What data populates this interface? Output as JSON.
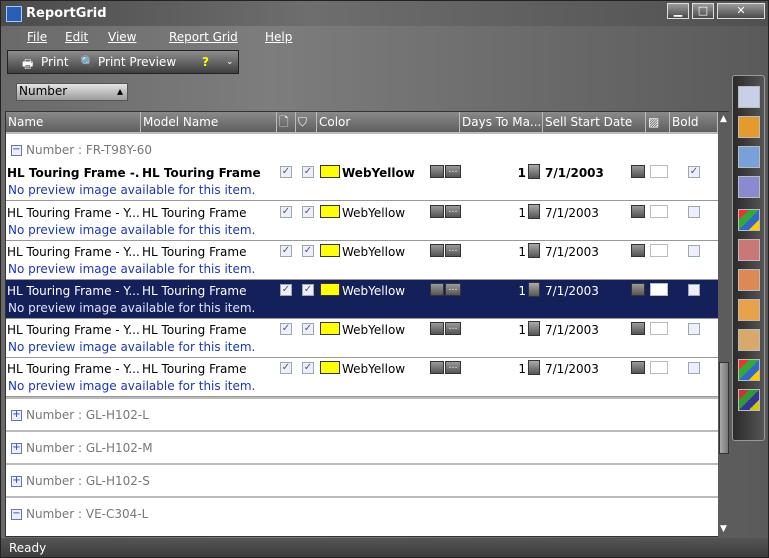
{
  "window": {
    "title": "ReportGrid",
    "min": "▁",
    "max": "□",
    "close": "✕"
  },
  "menu": [
    "File",
    "Edit",
    "View",
    "Report Grid",
    "Help"
  ],
  "toolbar": {
    "print": "Print",
    "print_preview": "Print Preview",
    "help": "?"
  },
  "groupby": {
    "label": "Number"
  },
  "columns": [
    "Name",
    "Model Name",
    "",
    "",
    "Color",
    "Days To Ma...",
    "Sell Start Date",
    "",
    "Bold"
  ],
  "groups": [
    {
      "label": "Number : FR-T98Y-60",
      "expanded": true
    },
    {
      "label": "Number : GL-H102-L",
      "expanded": false
    },
    {
      "label": "Number : GL-H102-M",
      "expanded": false
    },
    {
      "label": "Number : GL-H102-S",
      "expanded": false
    },
    {
      "label": "Number : VE-C304-L",
      "expanded": true
    }
  ],
  "records": [
    {
      "name": "HL Touring Frame -...",
      "model": "HL Touring Frame",
      "color": "WebYellow",
      "days": "1",
      "date": "7/1/2003",
      "preview": "No preview image available for this item.",
      "bold": true,
      "selected": false
    },
    {
      "name": "HL Touring Frame - Y...",
      "model": "HL Touring Frame",
      "color": "WebYellow",
      "days": "1",
      "date": "7/1/2003",
      "preview": "No preview image available for this item.",
      "bold": false,
      "selected": false
    },
    {
      "name": "HL Touring Frame - Y...",
      "model": "HL Touring Frame",
      "color": "WebYellow",
      "days": "1",
      "date": "7/1/2003",
      "preview": "No preview image available for this item.",
      "bold": false,
      "selected": false
    },
    {
      "name": "HL Touring Frame - Y...",
      "model": "HL Touring Frame",
      "color": "WebYellow",
      "days": "1",
      "date": "7/1/2003",
      "preview": "No preview image available for this item.",
      "bold": false,
      "selected": true
    },
    {
      "name": "HL Touring Frame - Y...",
      "model": "HL Touring Frame",
      "color": "WebYellow",
      "days": "1",
      "date": "7/1/2003",
      "preview": "No preview image available for this item.",
      "bold": false,
      "selected": false
    },
    {
      "name": "HL Touring Frame - Y...",
      "model": "HL Touring Frame",
      "color": "WebYellow",
      "days": "1",
      "date": "7/1/2003",
      "preview": "No preview image available for this item.",
      "bold": false,
      "selected": false
    }
  ],
  "status": {
    "text": "Ready"
  },
  "sidebar_icons": [
    "grid-icon",
    "grid-icon",
    "grid-icon",
    "grid-icon",
    "windows-icon",
    "badge-icon",
    "badge-icon",
    "grid-icon",
    "grid-icon",
    "windows-icon",
    "windows-icon"
  ]
}
